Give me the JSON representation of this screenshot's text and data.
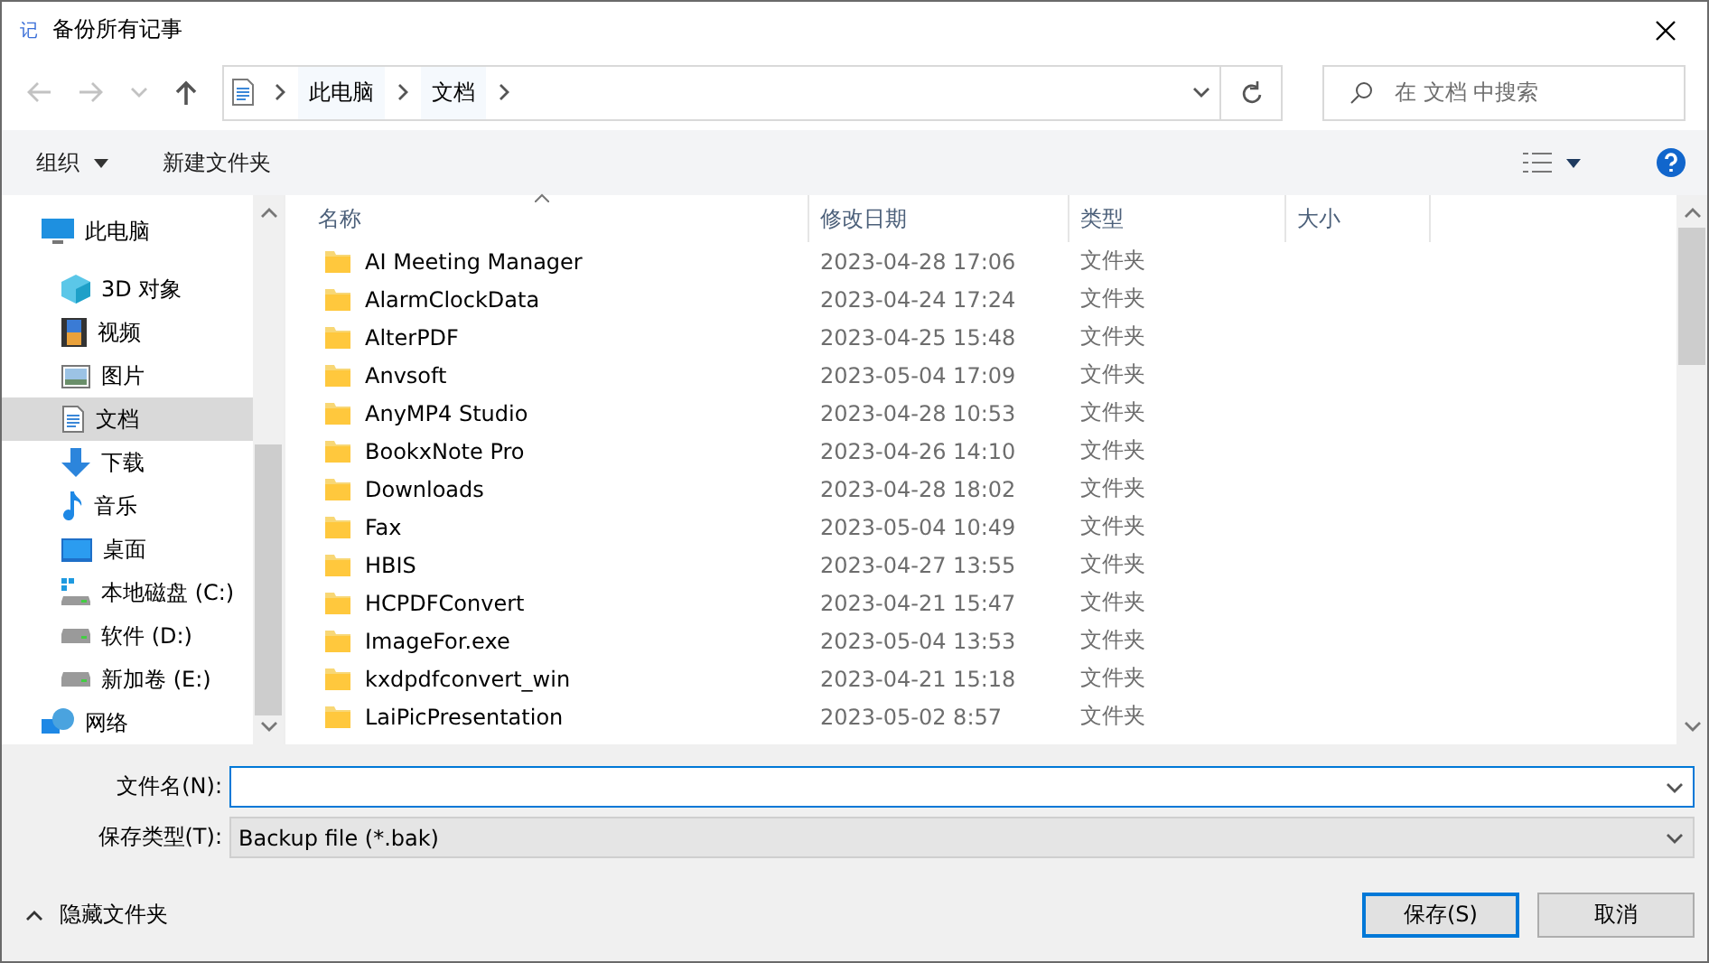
{
  "window": {
    "title": "备份所有记事",
    "app_icon": "记"
  },
  "address": {
    "crumbs": [
      "此电脑",
      "文档"
    ]
  },
  "search": {
    "placeholder": "在 文档 中搜索"
  },
  "toolbar": {
    "organize": "组织",
    "new_folder": "新建文件夹"
  },
  "sidebar": {
    "items": [
      {
        "label": "此电脑",
        "kind": "computer",
        "selected": false,
        "children": [
          {
            "label": "3D 对象",
            "kind": "cube",
            "selected": false
          },
          {
            "label": "视频",
            "kind": "film",
            "selected": false
          },
          {
            "label": "图片",
            "kind": "image",
            "selected": false
          },
          {
            "label": "文档",
            "kind": "document",
            "selected": true
          },
          {
            "label": "下载",
            "kind": "download",
            "selected": false
          },
          {
            "label": "音乐",
            "kind": "music",
            "selected": false
          },
          {
            "label": "桌面",
            "kind": "desktop",
            "selected": false
          },
          {
            "label": "本地磁盘 (C:)",
            "kind": "system-drive",
            "selected": false
          },
          {
            "label": "软件 (D:)",
            "kind": "drive",
            "selected": false
          },
          {
            "label": "新加卷 (E:)",
            "kind": "drive",
            "selected": false
          }
        ]
      },
      {
        "label": "网络",
        "kind": "network",
        "selected": false
      }
    ]
  },
  "table": {
    "columns": [
      "名称",
      "修改日期",
      "类型",
      "大小"
    ],
    "rows": [
      {
        "name": "AI Meeting Manager",
        "date": "2023-04-28 17:06",
        "type": "文件夹"
      },
      {
        "name": "AlarmClockData",
        "date": "2023-04-24 17:24",
        "type": "文件夹"
      },
      {
        "name": "AlterPDF",
        "date": "2023-04-25 15:48",
        "type": "文件夹"
      },
      {
        "name": "Anvsoft",
        "date": "2023-05-04 17:09",
        "type": "文件夹"
      },
      {
        "name": "AnyMP4 Studio",
        "date": "2023-04-28 10:53",
        "type": "文件夹"
      },
      {
        "name": "BookxNote Pro",
        "date": "2023-04-26 14:10",
        "type": "文件夹"
      },
      {
        "name": "Downloads",
        "date": "2023-04-28 18:02",
        "type": "文件夹"
      },
      {
        "name": "Fax",
        "date": "2023-05-04 10:49",
        "type": "文件夹"
      },
      {
        "name": "HBIS",
        "date": "2023-04-27 13:55",
        "type": "文件夹"
      },
      {
        "name": "HCPDFConvert",
        "date": "2023-04-21 15:47",
        "type": "文件夹"
      },
      {
        "name": "ImageFor.exe",
        "date": "2023-05-04 13:53",
        "type": "文件夹"
      },
      {
        "name": "kxdpdfconvert_win",
        "date": "2023-04-21 15:18",
        "type": "文件夹"
      },
      {
        "name": "LaiPicPresentation",
        "date": "2023-05-02 8:57",
        "type": "文件夹"
      }
    ]
  },
  "form": {
    "filename_label": "文件名(N):",
    "filetype_label": "保存类型(T):",
    "filetype_value": "Backup file (*.bak)"
  },
  "hide_folders": "隐藏文件夹",
  "buttons": {
    "save": "保存(S)",
    "cancel": "取消"
  }
}
